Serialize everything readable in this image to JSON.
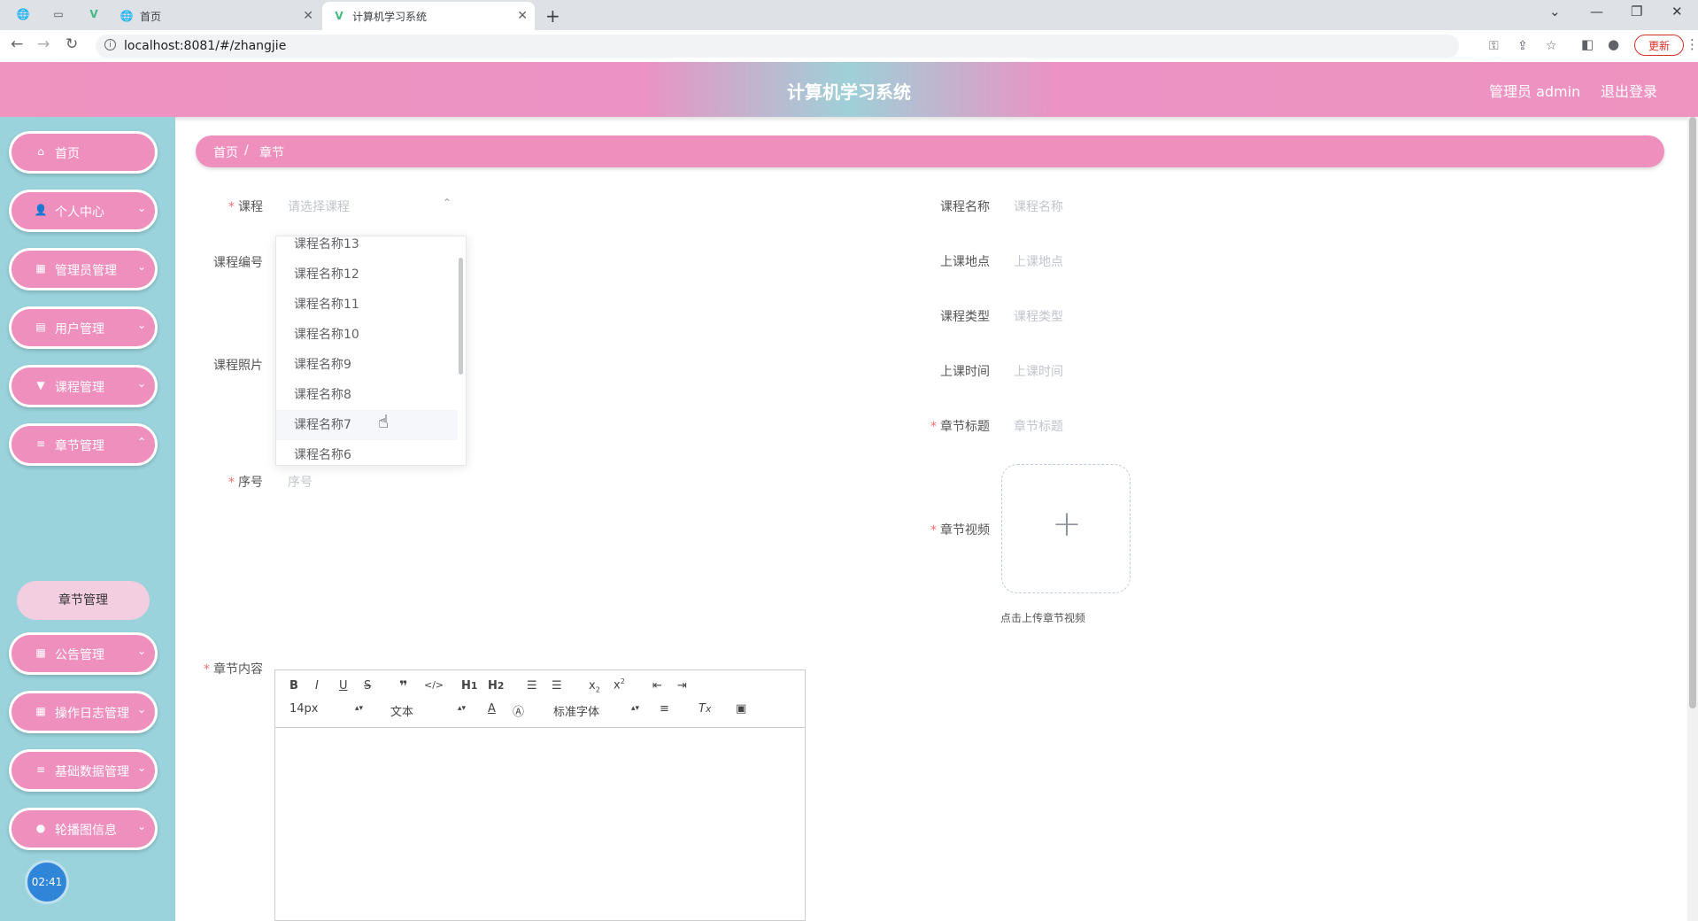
{
  "browser": {
    "tabs": [
      {
        "title": "首页",
        "icon": "globe-icon"
      },
      {
        "title": "计算机学习系统",
        "icon": "vue-icon"
      }
    ],
    "url": "localhost:8081/#/zhangjie",
    "update_label": "更新"
  },
  "header": {
    "title": "计算机学习系统",
    "user": "管理员 admin",
    "logout": "退出登录"
  },
  "sidebar": {
    "items": [
      {
        "label": "首页",
        "icon": "home-icon"
      },
      {
        "label": "个人中心",
        "icon": "user-icon"
      },
      {
        "label": "管理员管理",
        "icon": "grid-icon"
      },
      {
        "label": "用户管理",
        "icon": "clipboard-icon"
      },
      {
        "label": "课程管理",
        "icon": "cup-icon"
      },
      {
        "label": "章节管理",
        "icon": "list-icon"
      },
      {
        "label": "公告管理",
        "icon": "apps-icon"
      },
      {
        "label": "操作日志管理",
        "icon": "grid-icon"
      },
      {
        "label": "基础数据管理",
        "icon": "list-icon"
      },
      {
        "label": "轮播图信息",
        "icon": "location-icon"
      }
    ],
    "submenu": "章节管理",
    "clock": "02:41"
  },
  "breadcrumb": {
    "home": "首页",
    "separator": "/",
    "current": "章节"
  },
  "form": {
    "course": {
      "label": "课程",
      "placeholder": "请选择课程"
    },
    "course_no": {
      "label": "课程编号"
    },
    "course_photo": {
      "label": "课程照片"
    },
    "seq": {
      "label": "序号",
      "placeholder": "序号"
    },
    "course_name": {
      "label": "课程名称",
      "placeholder": "课程名称"
    },
    "location": {
      "label": "上课地点",
      "placeholder": "上课地点"
    },
    "course_type": {
      "label": "课程类型",
      "placeholder": "课程类型"
    },
    "class_time": {
      "label": "上课时间",
      "placeholder": "上课时间"
    },
    "chapter_title": {
      "label": "章节标题",
      "placeholder": "章节标题"
    },
    "chapter_video": {
      "label": "章节视频",
      "hint": "点击上传章节视频"
    },
    "chapter_content": {
      "label": "章节内容"
    }
  },
  "dropdown": {
    "options": [
      "课程名称13",
      "课程名称12",
      "课程名称11",
      "课程名称10",
      "课程名称9",
      "课程名称8",
      "课程名称7",
      "课程名称6"
    ],
    "hovered_index": 6
  },
  "editor": {
    "font_size": "14px",
    "block_format": "文本",
    "font_family": "标准字体"
  }
}
